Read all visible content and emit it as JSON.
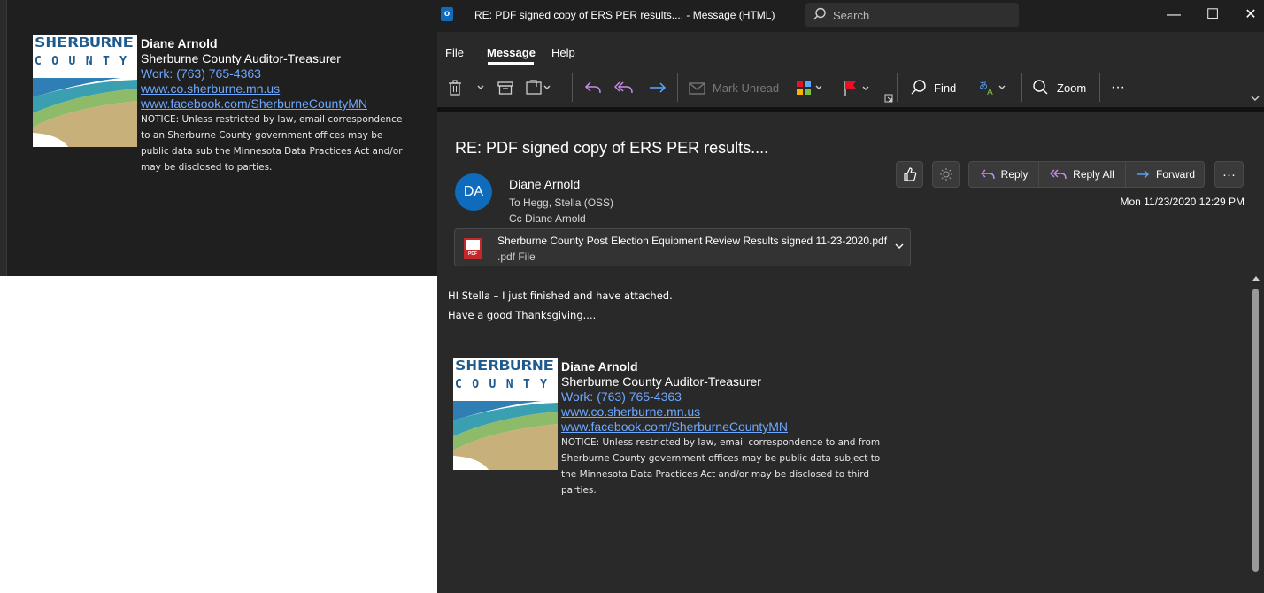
{
  "signature": {
    "logo_text_top": "SHERBURNE",
    "logo_text_bottom": "COUNTY",
    "name": "Diane Arnold",
    "title": "Sherburne County Auditor-Treasurer",
    "work": "Work: (763) 765-4363",
    "website": "www.co.sherburne.mn.us",
    "facebook": "www.facebook.com/SherburneCountyMN",
    "notice_bg": "NOTICE: Unless restricted by law, email correspondence to an Sherburne County government offices may be public data sub the Minnesota Data Practices Act and/or may be disclosed to parties.",
    "notice": "NOTICE: Unless restricted by law, email correspondence to and from Sherburne County government offices may be public data subject to the Minnesota Data Practices Act and/or may be disclosed to third parties."
  },
  "window": {
    "app_icon": "o",
    "title": "RE: PDF signed copy of ERS PER results.... - Message (HTML)",
    "search_placeholder": "Search",
    "controls": {
      "minimize": "—",
      "maximize": "☐",
      "close": "✕"
    }
  },
  "menu": {
    "file": "File",
    "message": "Message",
    "help": "Help"
  },
  "ribbon": {
    "mark_unread": "Mark Unread",
    "find": "Find",
    "zoom": "Zoom",
    "more": "···"
  },
  "message": {
    "subject": "RE: PDF signed copy of ERS PER results....",
    "avatar_initials": "DA",
    "sender": "Diane Arnold",
    "to": "To  Hegg, Stella (OSS)",
    "cc": "Cc  Diane Arnold",
    "date": "Mon 11/23/2020 12:29 PM",
    "actions": {
      "reply": "Reply",
      "reply_all": "Reply All",
      "forward": "Forward",
      "more": "···"
    },
    "attachment": {
      "name": "Sherburne County Post Election Equipment Review Results signed 11-23-2020.pdf",
      "type": ".pdf File",
      "badge": "PDF"
    },
    "body": [
      "HI Stella – I just finished and have attached.",
      "Have a good Thanksgiving...."
    ]
  },
  "colors": {
    "accent": "#0f6cbd",
    "link": "#6ea8ff",
    "flag": "#e81123"
  }
}
